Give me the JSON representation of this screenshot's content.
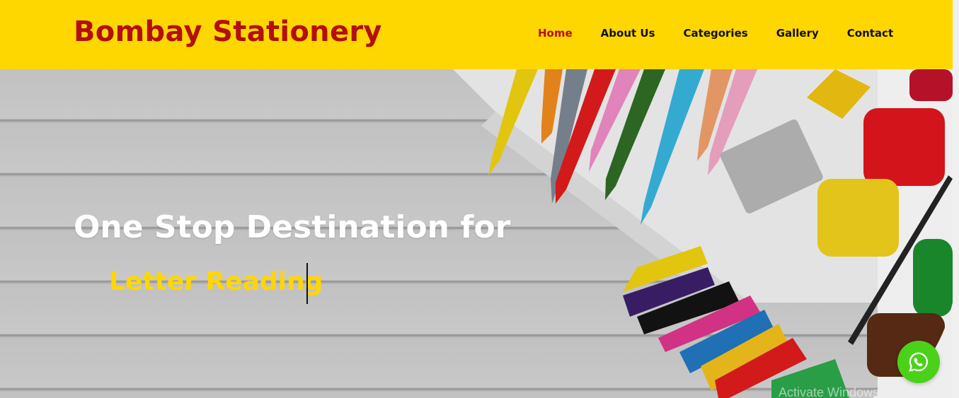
{
  "header": {
    "brand": "Bombay Stationery",
    "nav": [
      {
        "label": "Home",
        "active": true
      },
      {
        "label": "About Us"
      },
      {
        "label": "Categories"
      },
      {
        "label": "Gallery"
      },
      {
        "label": "Contact"
      }
    ]
  },
  "hero": {
    "title": "One Stop Destination for",
    "typed_text": "Letter Reading"
  },
  "overlay": {
    "windows_notice": "Activate Windows"
  },
  "icons": {
    "chat": "whatsapp-icon"
  },
  "colors": {
    "header_bg": "#FFD700",
    "brand": "#B30F0F",
    "accent_text": "#FFD700",
    "whatsapp": "#4CD11A"
  }
}
